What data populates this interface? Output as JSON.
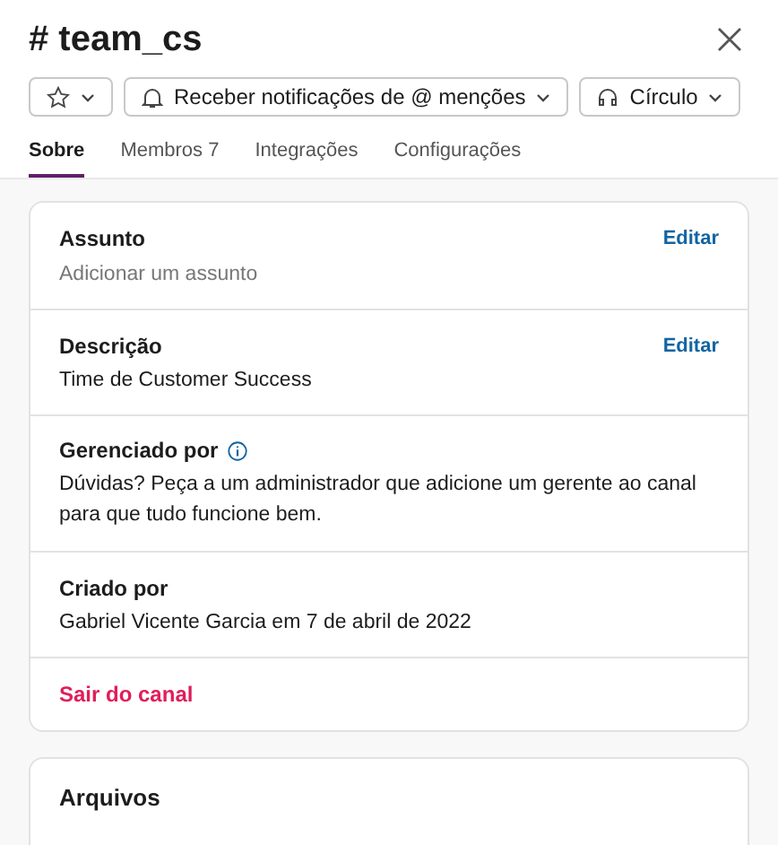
{
  "title": "# team_cs",
  "actions": [
    {
      "kind": "star"
    },
    {
      "kind": "bell",
      "label": "Receber notificações de @ menções"
    },
    {
      "kind": "headphones",
      "label": "Círculo"
    }
  ],
  "tabs": [
    {
      "label": "Sobre",
      "selected": true
    },
    {
      "label": "Membros 7",
      "selected": false
    },
    {
      "label": "Integrações",
      "selected": false
    },
    {
      "label": "Configurações",
      "selected": false
    }
  ],
  "sections": [
    {
      "kind": "field",
      "title": "Assunto",
      "value": "Adicionar um assunto",
      "placeholder": true,
      "action": "Editar"
    },
    {
      "kind": "field",
      "title": "Descrição",
      "value": "Time de Customer Success",
      "placeholder": false,
      "action": "Editar"
    },
    {
      "kind": "info",
      "title": "Gerenciado por",
      "value": "Dúvidas? Peça a um administrador que adicione um gerente ao canal para que tudo funcione bem."
    },
    {
      "kind": "field",
      "title": "Criado por",
      "value": "Gabriel Vicente Garcia em 7 de abril de 2022"
    },
    {
      "kind": "danger",
      "title": "Sair do canal"
    }
  ],
  "files": {
    "title": "Arquivos"
  }
}
